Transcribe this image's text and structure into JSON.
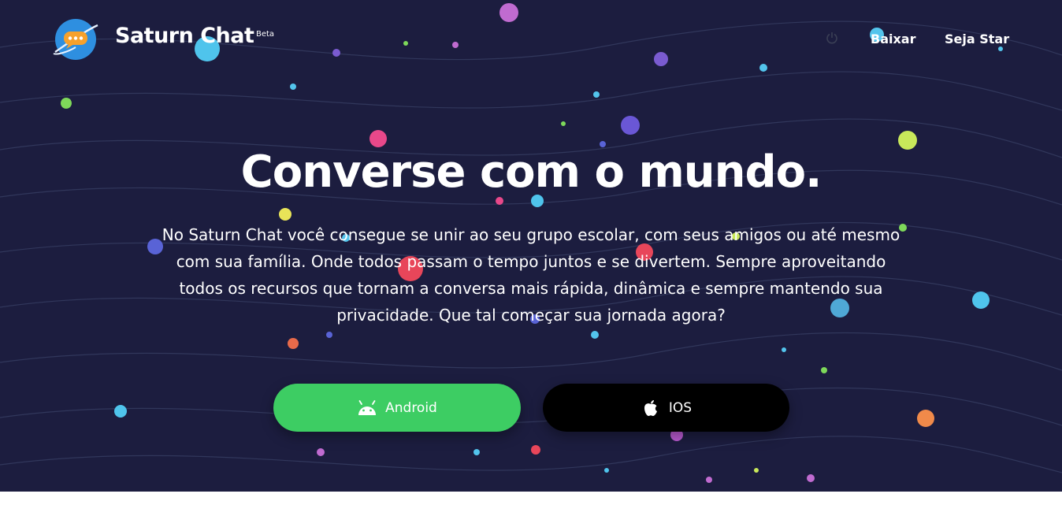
{
  "brand": {
    "name": "Saturn Chat",
    "badge": "Beta",
    "logo_icon": "saturn-chat-logo-icon"
  },
  "nav": {
    "power_icon": "power-icon",
    "links": [
      {
        "label": "Baixar"
      },
      {
        "label": "Seja Star"
      }
    ]
  },
  "hero": {
    "title": "Converse com o mundo.",
    "description": "No Saturn Chat você consegue se unir ao seu grupo escolar, com seus amigos ou até mesmo com sua família. Onde todos passam o tempo juntos e se divertem. Sempre aproveitando todos os recursos que tornam a conversa mais rápida, dinâmica e sempre mantendo sua privacidade. Que tal começar sua jornada agora?",
    "buttons": [
      {
        "label": "Android",
        "icon": "android-icon",
        "color": "#3dcd63"
      },
      {
        "label": "IOS",
        "icon": "apple-icon",
        "color": "#000000"
      }
    ]
  },
  "colors": {
    "background": "#1c1d3f",
    "text": "#ffffff",
    "logo_blue": "#2e8fe0",
    "logo_orange": "#f6a12c"
  }
}
